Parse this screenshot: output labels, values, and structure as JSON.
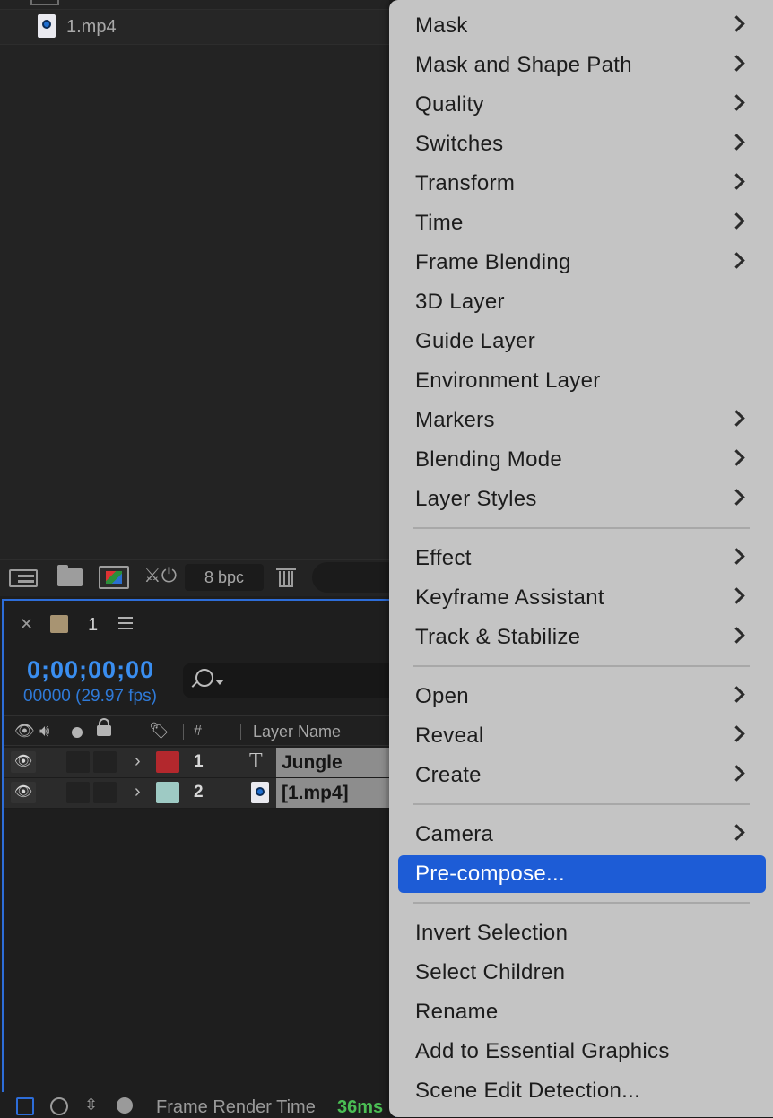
{
  "project": {
    "file_name": "1.mp4",
    "bpc": "8 bpc"
  },
  "timeline": {
    "comp_tab": "1",
    "timecode": "0;00;00;00",
    "frame_count": "00000 (29.97 fps)",
    "columns": {
      "number": "#",
      "layer_name": "Layer Name"
    },
    "layers": [
      {
        "number": "1",
        "name": "Jungle",
        "label_color": "#b3282d",
        "type_icon": "text-layer-icon",
        "type_glyph": "T"
      },
      {
        "number": "2",
        "name": "[1.mp4]",
        "label_color": "#9ecac4",
        "type_icon": "footage-icon"
      }
    ],
    "status": {
      "render_label": "Frame Render Time",
      "render_value": "36ms"
    }
  },
  "menu": {
    "highlight_color": "#1d5cd6",
    "items": [
      {
        "label": "Mask",
        "submenu": true
      },
      {
        "label": "Mask and Shape Path",
        "submenu": true
      },
      {
        "label": "Quality",
        "submenu": true
      },
      {
        "label": "Switches",
        "submenu": true
      },
      {
        "label": "Transform",
        "submenu": true
      },
      {
        "label": "Time",
        "submenu": true
      },
      {
        "label": "Frame Blending",
        "submenu": true
      },
      {
        "label": "3D Layer",
        "submenu": false
      },
      {
        "label": "Guide Layer",
        "submenu": false
      },
      {
        "label": "Environment Layer",
        "submenu": false
      },
      {
        "label": "Markers",
        "submenu": true
      },
      {
        "label": "Blending Mode",
        "submenu": true
      },
      {
        "label": "Layer Styles",
        "submenu": true
      },
      {
        "label": "Effect",
        "submenu": true
      },
      {
        "label": "Keyframe Assistant",
        "submenu": true
      },
      {
        "label": "Track & Stabilize",
        "submenu": true
      },
      {
        "label": "Open",
        "submenu": true
      },
      {
        "label": "Reveal",
        "submenu": true
      },
      {
        "label": "Create",
        "submenu": true
      },
      {
        "label": "Camera",
        "submenu": true
      },
      {
        "label": "Pre-compose...",
        "submenu": false,
        "highlighted": true
      },
      {
        "label": "Invert Selection",
        "submenu": false
      },
      {
        "label": "Select Children",
        "submenu": false
      },
      {
        "label": "Rename",
        "submenu": false
      },
      {
        "label": "Add to Essential Graphics",
        "submenu": false
      },
      {
        "label": "Scene Edit Detection...",
        "submenu": false
      }
    ]
  }
}
